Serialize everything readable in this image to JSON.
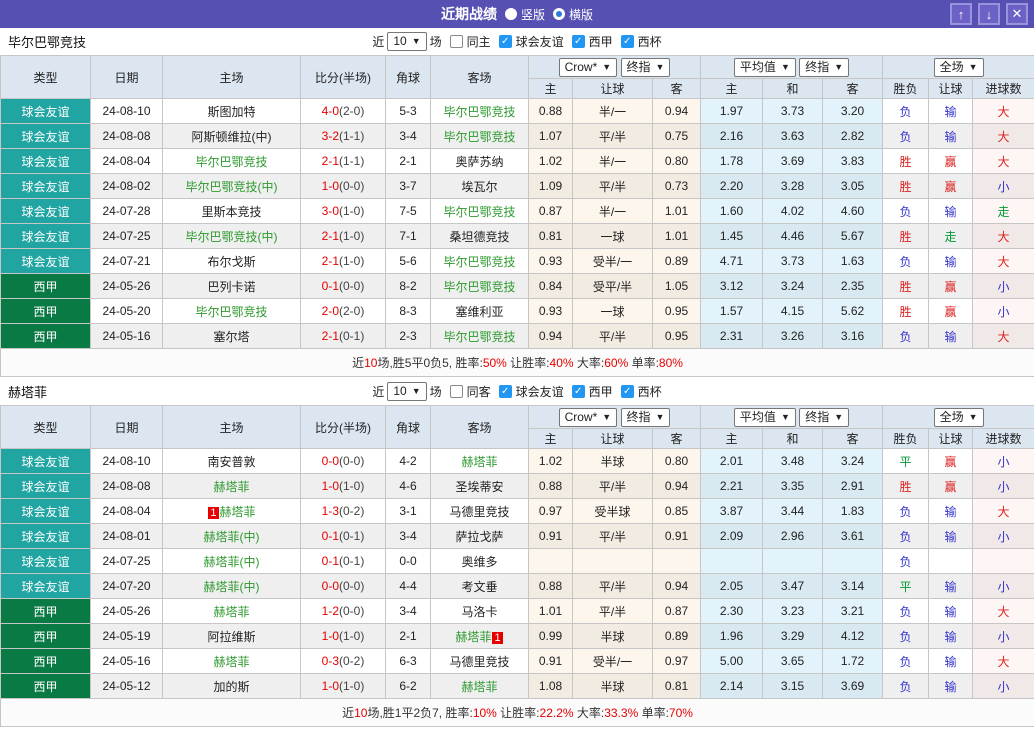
{
  "colors": {
    "titlebar": "#5650B2",
    "friendly_type": "#21A5A2",
    "league_type": "#0A7A44",
    "win_red": "#DD2222",
    "lose_blue": "#3333CC",
    "draw_green": "#009933",
    "focus_team_green": "#2E9A2E",
    "score_red": "#E60000",
    "header_bg": "#DCE6F1"
  },
  "titlebar": {
    "title": "近期战绩",
    "radio_vertical": "竖版",
    "radio_horizontal": "横版",
    "up": "↑",
    "down": "↓",
    "close": "✕"
  },
  "filter": {
    "near_label": "近",
    "count": "10",
    "matches_label": "场",
    "comps": [
      "球会友谊",
      "西甲",
      "西杯"
    ]
  },
  "table_header": {
    "static_cols": [
      "类型",
      "日期",
      "主场",
      "比分(半场)",
      "角球",
      "客场"
    ],
    "groups": [
      {
        "selects": [
          "Crow*",
          "终指"
        ],
        "cols": [
          "主",
          "让球",
          "客"
        ]
      },
      {
        "selects": [
          "平均值",
          "终指"
        ],
        "cols": [
          "主",
          "和",
          "客"
        ]
      },
      {
        "selects": [
          "全场"
        ],
        "cols": [
          "胜负",
          "让球",
          "进球数"
        ]
      }
    ]
  },
  "teams": [
    {
      "name": "毕尔巴鄂竞技",
      "same_label": "同主",
      "rows": [
        {
          "type": "球会友谊",
          "type_class": "friendly",
          "date": "24-08-10",
          "home": "斯图加特",
          "score": "4-0",
          "half": "(2-0)",
          "corner": "5-3",
          "away": "毕尔巴鄂竞技",
          "away_focus": true,
          "o1": "0.88",
          "hcap": "半/一",
          "o2": "0.94",
          "a1": "1.97",
          "a2": "3.73",
          "a3": "3.20",
          "wdl": "负",
          "wdl_c": "blue",
          "hres": "输",
          "hres_c": "blue",
          "ou": "大",
          "ou_c": "red"
        },
        {
          "type": "球会友谊",
          "type_class": "friendly",
          "date": "24-08-08",
          "home": "阿斯顿维拉(中)",
          "score": "3-2",
          "half": "(1-1)",
          "corner": "3-4",
          "away": "毕尔巴鄂竞技",
          "away_focus": true,
          "o1": "1.07",
          "hcap": "平/半",
          "o2": "0.75",
          "a1": "2.16",
          "a2": "3.63",
          "a3": "2.82",
          "wdl": "负",
          "wdl_c": "blue",
          "hres": "输",
          "hres_c": "blue",
          "ou": "大",
          "ou_c": "red"
        },
        {
          "type": "球会友谊",
          "type_class": "friendly",
          "date": "24-08-04",
          "home": "毕尔巴鄂竞技",
          "home_focus": true,
          "score": "2-1",
          "half": "(1-1)",
          "corner": "2-1",
          "away": "奥萨苏纳",
          "o1": "1.02",
          "hcap": "半/一",
          "o2": "0.80",
          "a1": "1.78",
          "a2": "3.69",
          "a3": "3.83",
          "wdl": "胜",
          "wdl_c": "red",
          "hres": "赢",
          "hres_c": "red",
          "ou": "大",
          "ou_c": "red"
        },
        {
          "type": "球会友谊",
          "type_class": "friendly",
          "date": "24-08-02",
          "home": "毕尔巴鄂竞技(中)",
          "home_focus": true,
          "score": "1-0",
          "half": "(0-0)",
          "corner": "3-7",
          "away": "埃瓦尔",
          "o1": "1.09",
          "hcap": "平/半",
          "o2": "0.73",
          "a1": "2.20",
          "a2": "3.28",
          "a3": "3.05",
          "wdl": "胜",
          "wdl_c": "red",
          "hres": "赢",
          "hres_c": "red",
          "ou": "小",
          "ou_c": "blue"
        },
        {
          "type": "球会友谊",
          "type_class": "friendly",
          "date": "24-07-28",
          "home": "里斯本竞技",
          "score": "3-0",
          "half": "(1-0)",
          "corner": "7-5",
          "away": "毕尔巴鄂竞技",
          "away_focus": true,
          "o1": "0.87",
          "hcap": "半/一",
          "o2": "1.01",
          "a1": "1.60",
          "a2": "4.02",
          "a3": "4.60",
          "wdl": "负",
          "wdl_c": "blue",
          "hres": "输",
          "hres_c": "blue",
          "ou": "走",
          "ou_c": "green"
        },
        {
          "type": "球会友谊",
          "type_class": "friendly",
          "date": "24-07-25",
          "home": "毕尔巴鄂竞技(中)",
          "home_focus": true,
          "score": "2-1",
          "half": "(1-0)",
          "corner": "7-1",
          "away": "桑坦德竞技",
          "o1": "0.81",
          "hcap": "一球",
          "o2": "1.01",
          "a1": "1.45",
          "a2": "4.46",
          "a3": "5.67",
          "wdl": "胜",
          "wdl_c": "red",
          "hres": "走",
          "hres_c": "green",
          "ou": "大",
          "ou_c": "red"
        },
        {
          "type": "球会友谊",
          "type_class": "friendly",
          "date": "24-07-21",
          "home": "布尔戈斯",
          "score": "2-1",
          "half": "(1-0)",
          "corner": "5-6",
          "away": "毕尔巴鄂竞技",
          "away_focus": true,
          "o1": "0.93",
          "hcap": "受半/一",
          "o2": "0.89",
          "a1": "4.71",
          "a2": "3.73",
          "a3": "1.63",
          "wdl": "负",
          "wdl_c": "blue",
          "hres": "输",
          "hres_c": "blue",
          "ou": "大",
          "ou_c": "red"
        },
        {
          "type": "西甲",
          "type_class": "league",
          "date": "24-05-26",
          "home": "巴列卡诺",
          "score": "0-1",
          "half": "(0-0)",
          "corner": "8-2",
          "away": "毕尔巴鄂竞技",
          "away_focus": true,
          "o1": "0.84",
          "hcap": "受平/半",
          "o2": "1.05",
          "a1": "3.12",
          "a2": "3.24",
          "a3": "2.35",
          "wdl": "胜",
          "wdl_c": "red",
          "hres": "赢",
          "hres_c": "red",
          "ou": "小",
          "ou_c": "blue"
        },
        {
          "type": "西甲",
          "type_class": "league",
          "date": "24-05-20",
          "home": "毕尔巴鄂竞技",
          "home_focus": true,
          "score": "2-0",
          "half": "(2-0)",
          "corner": "8-3",
          "away": "塞维利亚",
          "o1": "0.93",
          "hcap": "一球",
          "o2": "0.95",
          "a1": "1.57",
          "a2": "4.15",
          "a3": "5.62",
          "wdl": "胜",
          "wdl_c": "red",
          "hres": "赢",
          "hres_c": "red",
          "ou": "小",
          "ou_c": "blue"
        },
        {
          "type": "西甲",
          "type_class": "league",
          "date": "24-05-16",
          "home": "塞尔塔",
          "score": "2-1",
          "half": "(0-1)",
          "corner": "2-3",
          "away": "毕尔巴鄂竞技",
          "away_focus": true,
          "o1": "0.94",
          "hcap": "平/半",
          "o2": "0.95",
          "a1": "2.31",
          "a2": "3.26",
          "a3": "3.16",
          "wdl": "负",
          "wdl_c": "blue",
          "hres": "输",
          "hres_c": "blue",
          "ou": "大",
          "ou_c": "red"
        }
      ],
      "summary": [
        {
          "t": "近",
          "r": false
        },
        {
          "t": "10",
          "r": true
        },
        {
          "t": "场,胜5平0负5, 胜率:",
          "r": false
        },
        {
          "t": "50%",
          "r": true
        },
        {
          "t": " 让胜率:",
          "r": false
        },
        {
          "t": "40%",
          "r": true
        },
        {
          "t": " 大率:",
          "r": false
        },
        {
          "t": "60%",
          "r": true
        },
        {
          "t": " 单率:",
          "r": false
        },
        {
          "t": "80%",
          "r": true
        }
      ]
    },
    {
      "name": "赫塔菲",
      "same_label": "同客",
      "rows": [
        {
          "type": "球会友谊",
          "type_class": "friendly",
          "date": "24-08-10",
          "home": "南安普敦",
          "score": "0-0",
          "half": "(0-0)",
          "corner": "4-2",
          "away": "赫塔菲",
          "away_focus": true,
          "o1": "1.02",
          "hcap": "半球",
          "o2": "0.80",
          "a1": "2.01",
          "a2": "3.48",
          "a3": "3.24",
          "wdl": "平",
          "wdl_c": "green",
          "hres": "赢",
          "hres_c": "red",
          "ou": "小",
          "ou_c": "blue"
        },
        {
          "type": "球会友谊",
          "type_class": "friendly",
          "date": "24-08-08",
          "home": "赫塔菲",
          "home_focus": true,
          "score": "1-0",
          "half": "(1-0)",
          "corner": "4-6",
          "away": "圣埃蒂安",
          "o1": "0.88",
          "hcap": "平/半",
          "o2": "0.94",
          "a1": "2.21",
          "a2": "3.35",
          "a3": "2.91",
          "wdl": "胜",
          "wdl_c": "red",
          "hres": "赢",
          "hres_c": "red",
          "ou": "小",
          "ou_c": "blue"
        },
        {
          "type": "球会友谊",
          "type_class": "friendly",
          "date": "24-08-04",
          "home": "赫塔菲",
          "home_focus": true,
          "home_badge": "1",
          "score": "1-3",
          "half": "(0-2)",
          "corner": "3-1",
          "away": "马德里竞技",
          "o1": "0.97",
          "hcap": "受半球",
          "o2": "0.85",
          "a1": "3.87",
          "a2": "3.44",
          "a3": "1.83",
          "wdl": "负",
          "wdl_c": "blue",
          "hres": "输",
          "hres_c": "blue",
          "ou": "大",
          "ou_c": "red"
        },
        {
          "type": "球会友谊",
          "type_class": "friendly",
          "date": "24-08-01",
          "home": "赫塔菲(中)",
          "home_focus": true,
          "score": "0-1",
          "half": "(0-1)",
          "corner": "3-4",
          "away": "萨拉戈萨",
          "o1": "0.91",
          "hcap": "平/半",
          "o2": "0.91",
          "a1": "2.09",
          "a2": "2.96",
          "a3": "3.61",
          "wdl": "负",
          "wdl_c": "blue",
          "hres": "输",
          "hres_c": "blue",
          "ou": "小",
          "ou_c": "blue"
        },
        {
          "type": "球会友谊",
          "type_class": "friendly",
          "date": "24-07-25",
          "home": "赫塔菲(中)",
          "home_focus": true,
          "score": "0-1",
          "half": "(0-1)",
          "corner": "0-0",
          "away": "奥维多",
          "o1": "",
          "hcap": "",
          "o2": "",
          "a1": "",
          "a2": "",
          "a3": "",
          "wdl": "负",
          "wdl_c": "blue",
          "hres": "",
          "ou": ""
        },
        {
          "type": "球会友谊",
          "type_class": "friendly",
          "date": "24-07-20",
          "home": "赫塔菲(中)",
          "home_focus": true,
          "score": "0-0",
          "half": "(0-0)",
          "corner": "4-4",
          "away": "考文垂",
          "o1": "0.88",
          "hcap": "平/半",
          "o2": "0.94",
          "a1": "2.05",
          "a2": "3.47",
          "a3": "3.14",
          "wdl": "平",
          "wdl_c": "green",
          "hres": "输",
          "hres_c": "blue",
          "ou": "小",
          "ou_c": "blue"
        },
        {
          "type": "西甲",
          "type_class": "league",
          "date": "24-05-26",
          "home": "赫塔菲",
          "home_focus": true,
          "score": "1-2",
          "half": "(0-0)",
          "corner": "3-4",
          "away": "马洛卡",
          "o1": "1.01",
          "hcap": "平/半",
          "o2": "0.87",
          "a1": "2.30",
          "a2": "3.23",
          "a3": "3.21",
          "wdl": "负",
          "wdl_c": "blue",
          "hres": "输",
          "hres_c": "blue",
          "ou": "大",
          "ou_c": "red"
        },
        {
          "type": "西甲",
          "type_class": "league",
          "date": "24-05-19",
          "home": "阿拉维斯",
          "score": "1-0",
          "half": "(1-0)",
          "corner": "2-1",
          "away": "赫塔菲",
          "away_focus": true,
          "away_badge": "1",
          "away_badge_after": true,
          "o1": "0.99",
          "hcap": "半球",
          "o2": "0.89",
          "a1": "1.96",
          "a2": "3.29",
          "a3": "4.12",
          "wdl": "负",
          "wdl_c": "blue",
          "hres": "输",
          "hres_c": "blue",
          "ou": "小",
          "ou_c": "blue"
        },
        {
          "type": "西甲",
          "type_class": "league",
          "date": "24-05-16",
          "home": "赫塔菲",
          "home_focus": true,
          "score": "0-3",
          "half": "(0-2)",
          "corner": "6-3",
          "away": "马德里竞技",
          "o1": "0.91",
          "hcap": "受半/一",
          "o2": "0.97",
          "a1": "5.00",
          "a2": "3.65",
          "a3": "1.72",
          "wdl": "负",
          "wdl_c": "blue",
          "hres": "输",
          "hres_c": "blue",
          "ou": "大",
          "ou_c": "red"
        },
        {
          "type": "西甲",
          "type_class": "league",
          "date": "24-05-12",
          "home": "加的斯",
          "score": "1-0",
          "half": "(1-0)",
          "corner": "6-2",
          "away": "赫塔菲",
          "away_focus": true,
          "o1": "1.08",
          "hcap": "半球",
          "o2": "0.81",
          "a1": "2.14",
          "a2": "3.15",
          "a3": "3.69",
          "wdl": "负",
          "wdl_c": "blue",
          "hres": "输",
          "hres_c": "blue",
          "ou": "小",
          "ou_c": "blue"
        }
      ],
      "summary": [
        {
          "t": "近",
          "r": false
        },
        {
          "t": "10",
          "r": true
        },
        {
          "t": "场,胜1平2负7, 胜率:",
          "r": false
        },
        {
          "t": "10%",
          "r": true
        },
        {
          "t": " 让胜率:",
          "r": false
        },
        {
          "t": "22.2%",
          "r": true
        },
        {
          "t": " 大率:",
          "r": false
        },
        {
          "t": "33.3%",
          "r": true
        },
        {
          "t": " 单率:",
          "r": false
        },
        {
          "t": "70%",
          "r": true
        }
      ]
    }
  ]
}
